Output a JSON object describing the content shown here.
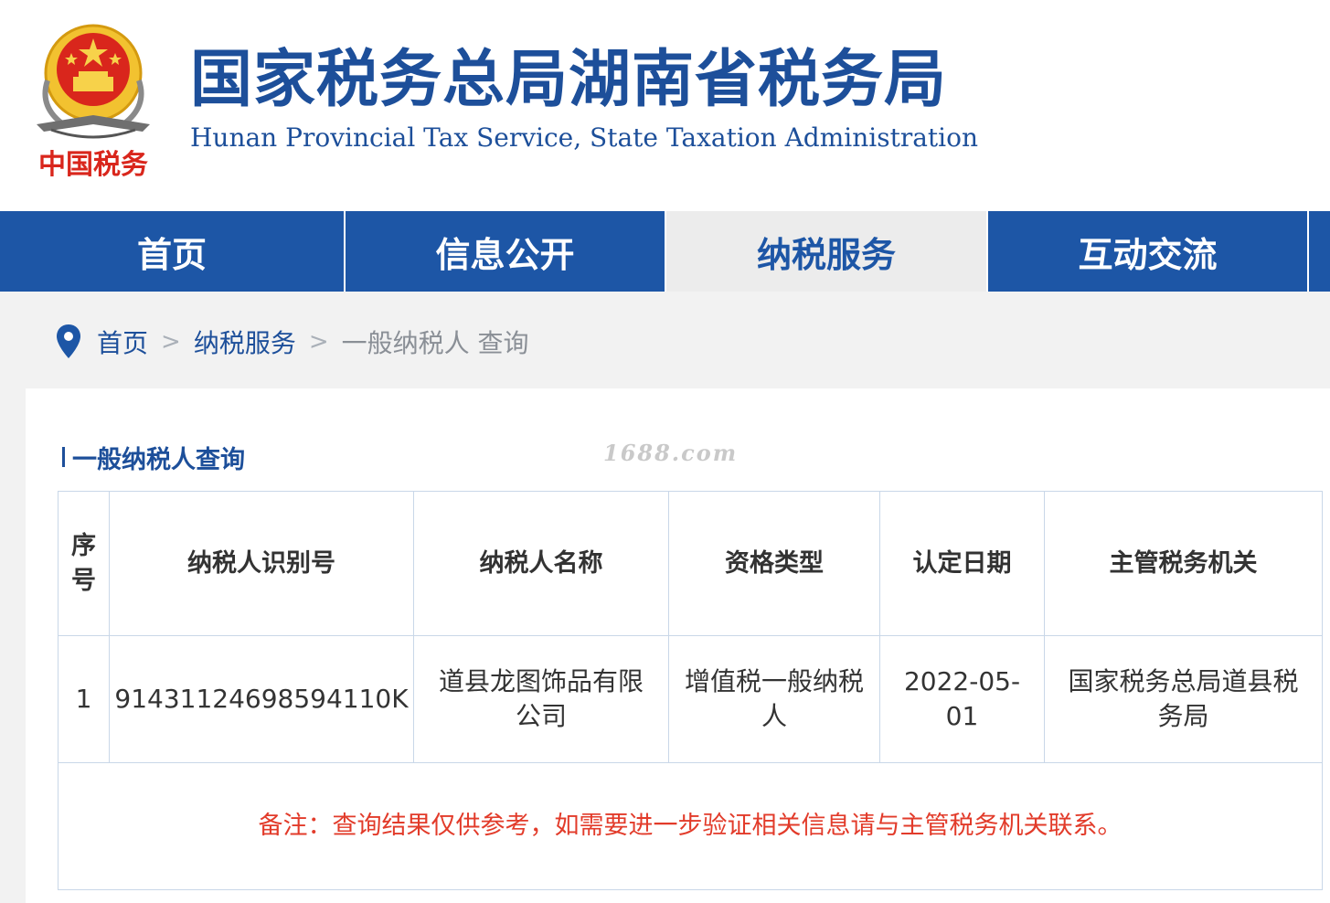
{
  "header": {
    "title_cn": "国家税务总局湖南省税务局",
    "title_en": "Hunan Provincial  Tax Service,  State Taxation Administration",
    "emblem_caption": "中国税务",
    "brand_color": "#1d4f9a"
  },
  "nav": {
    "items": [
      {
        "label": "首页",
        "active": false
      },
      {
        "label": "信息公开",
        "active": false
      },
      {
        "label": "纳税服务",
        "active": true
      },
      {
        "label": "互动交流",
        "active": false
      }
    ]
  },
  "breadcrumb": {
    "icon": "location-pin-icon",
    "home": "首页",
    "section": "纳税服务",
    "separator": ">",
    "current": "一般纳税人 查询"
  },
  "panel": {
    "section_title": "一般纳税人查询",
    "watermark": "1688.com"
  },
  "table": {
    "headers": [
      "序号",
      "纳税人识别号",
      "纳税人名称",
      "资格类型",
      "认定日期",
      "主管税务机关"
    ],
    "rows": [
      [
        "1",
        "91431124698594110K",
        "道县龙图饰品有限公司",
        "增值税一般纳税人",
        "2022-05-01",
        "国家税务总局道县税务局"
      ]
    ],
    "note": "备注：查询结果仅供参考，如需要进一步验证相关信息请与主管税务机关联系。",
    "note_color": "#e23b2a"
  }
}
